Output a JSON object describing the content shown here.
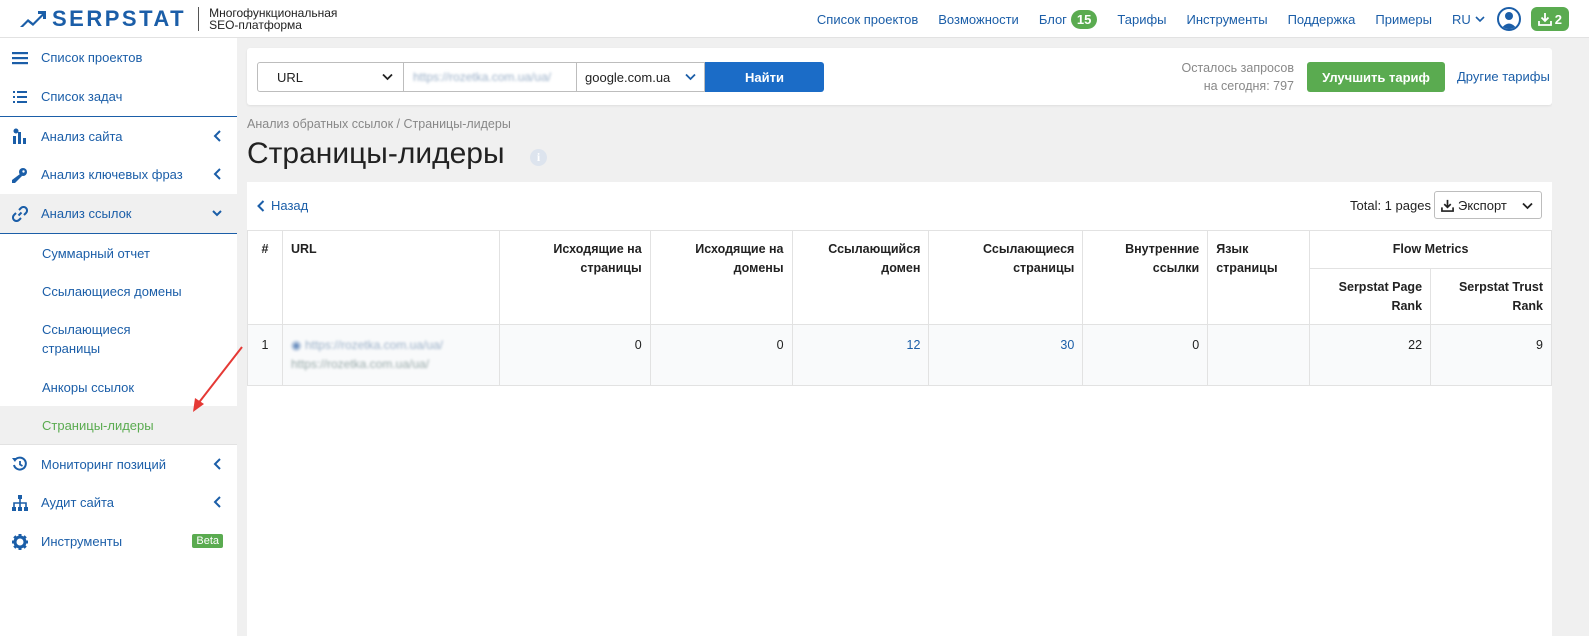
{
  "header": {
    "logo_text": "SERPSTAT",
    "tagline_line1": "Многофункциональная",
    "tagline_line2": "SEO-платформа",
    "nav": {
      "projects": "Список проектов",
      "features": "Возможности",
      "blog": "Блог",
      "blog_count": "15",
      "pricing": "Тарифы",
      "tools": "Инструменты",
      "support": "Поддержка",
      "examples": "Примеры",
      "lang": "RU",
      "downloads_count": "2"
    }
  },
  "sidebar": {
    "projects": "Список проектов",
    "tasks": "Список задач",
    "site_analysis": "Анализ сайта",
    "keyword_analysis": "Анализ ключевых фраз",
    "link_analysis": "Анализ ссылок",
    "sub": {
      "summary": "Суммарный отчет",
      "ref_domains": "Ссылающиеся домены",
      "ref_pages_1": "Ссылающиеся",
      "ref_pages_2": "страницы",
      "anchors": "Анкоры ссылок",
      "top_pages": "Страницы-лидеры"
    },
    "rank_tracking": "Мониторинг позиций",
    "site_audit": "Аудит сайта",
    "tools": "Инструменты",
    "beta": "Beta"
  },
  "search": {
    "type": "URL",
    "domain_value": "https://rozetka.com.ua/ua/",
    "engine": "google.com.ua",
    "find_button": "Найти",
    "quota_line1": "Осталось запросов",
    "quota_line2": "на сегодня: 797",
    "upgrade_button": "Улучшить тариф",
    "other_plans": "Другие тарифы"
  },
  "breadcrumb": "Анализ обратных ссылок / Страницы-лидеры",
  "page_title": "Страницы-лидеры",
  "panel": {
    "back": "Назад",
    "total": "Total: 1 pages",
    "export": "Экспорт"
  },
  "table": {
    "headers": {
      "num": "#",
      "url": "URL",
      "out_pages_1": "Исходящие на",
      "out_pages_2": "страницы",
      "out_domains_1": "Исходящие на",
      "out_domains_2": "домены",
      "ref_domain_1": "Ссылающийся",
      "ref_domain_2": "домен",
      "ref_pages_1": "Ссылающиеся",
      "ref_pages_2": "страницы",
      "internal_1": "Внутренние",
      "internal_2": "ссылки",
      "lang_1": "Язык",
      "lang_2": "страницы",
      "flow_metrics": "Flow Metrics",
      "page_rank_1": "Serpstat Page",
      "page_rank_2": "Rank",
      "trust_rank_1": "Serpstat Trust",
      "trust_rank_2": "Rank"
    },
    "rows": [
      {
        "num": "1",
        "url": "https://rozetka.com.ua/ua/",
        "url_sub": "https://rozetka.com.ua/ua/",
        "out_pages": "0",
        "out_domains": "0",
        "ref_domain": "12",
        "ref_pages": "30",
        "internal": "0",
        "lang": "",
        "page_rank": "22",
        "trust_rank": "9"
      }
    ]
  }
}
